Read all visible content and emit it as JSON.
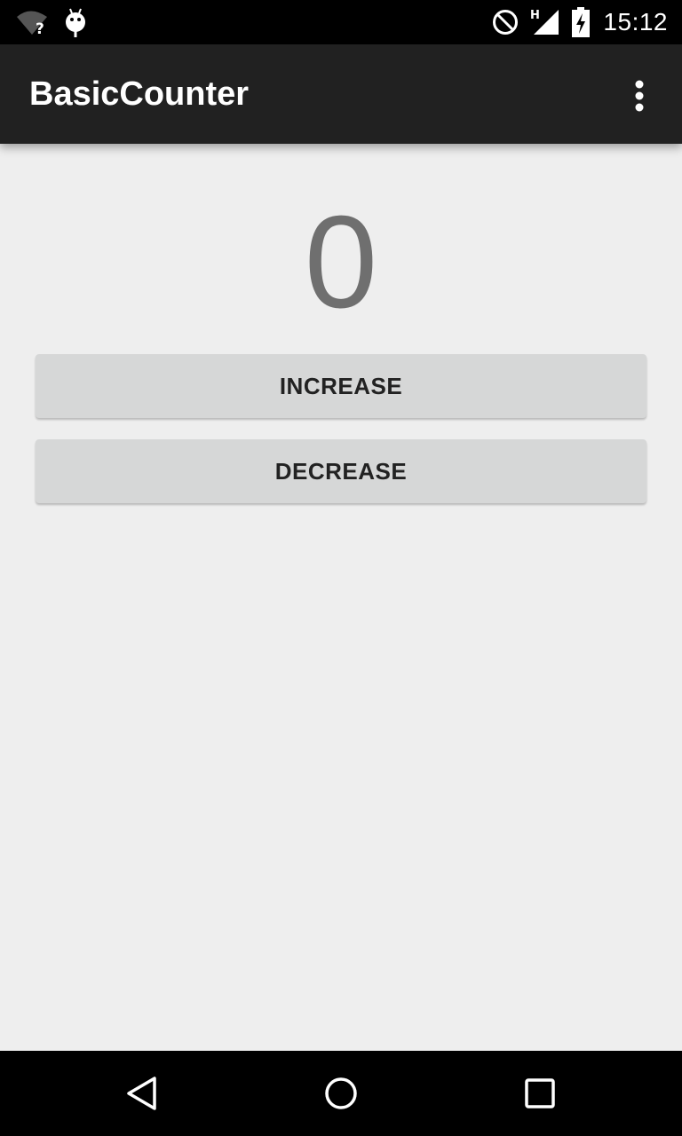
{
  "status_bar": {
    "time": "15:12",
    "icons_left": [
      "wifi-unknown-icon",
      "android-debug-icon"
    ],
    "icons_right": [
      "do-not-disturb-icon",
      "cell-signal-h-icon",
      "battery-charging-icon"
    ],
    "network_type": "H"
  },
  "app_bar": {
    "title": "BasicCounter",
    "overflow_icon": "more-vert-icon"
  },
  "counter": {
    "value": "0"
  },
  "buttons": {
    "increase_label": "INCREASE",
    "decrease_label": "DECREASE"
  },
  "nav_bar": {
    "icons": [
      "back-icon",
      "home-icon",
      "recents-icon"
    ]
  },
  "colors": {
    "status_bar": "#000000",
    "app_bar": "#212121",
    "background": "#eeeeee",
    "button": "#d6d7d7",
    "counter_text": "#6f6f6f",
    "button_text": "#222222"
  }
}
